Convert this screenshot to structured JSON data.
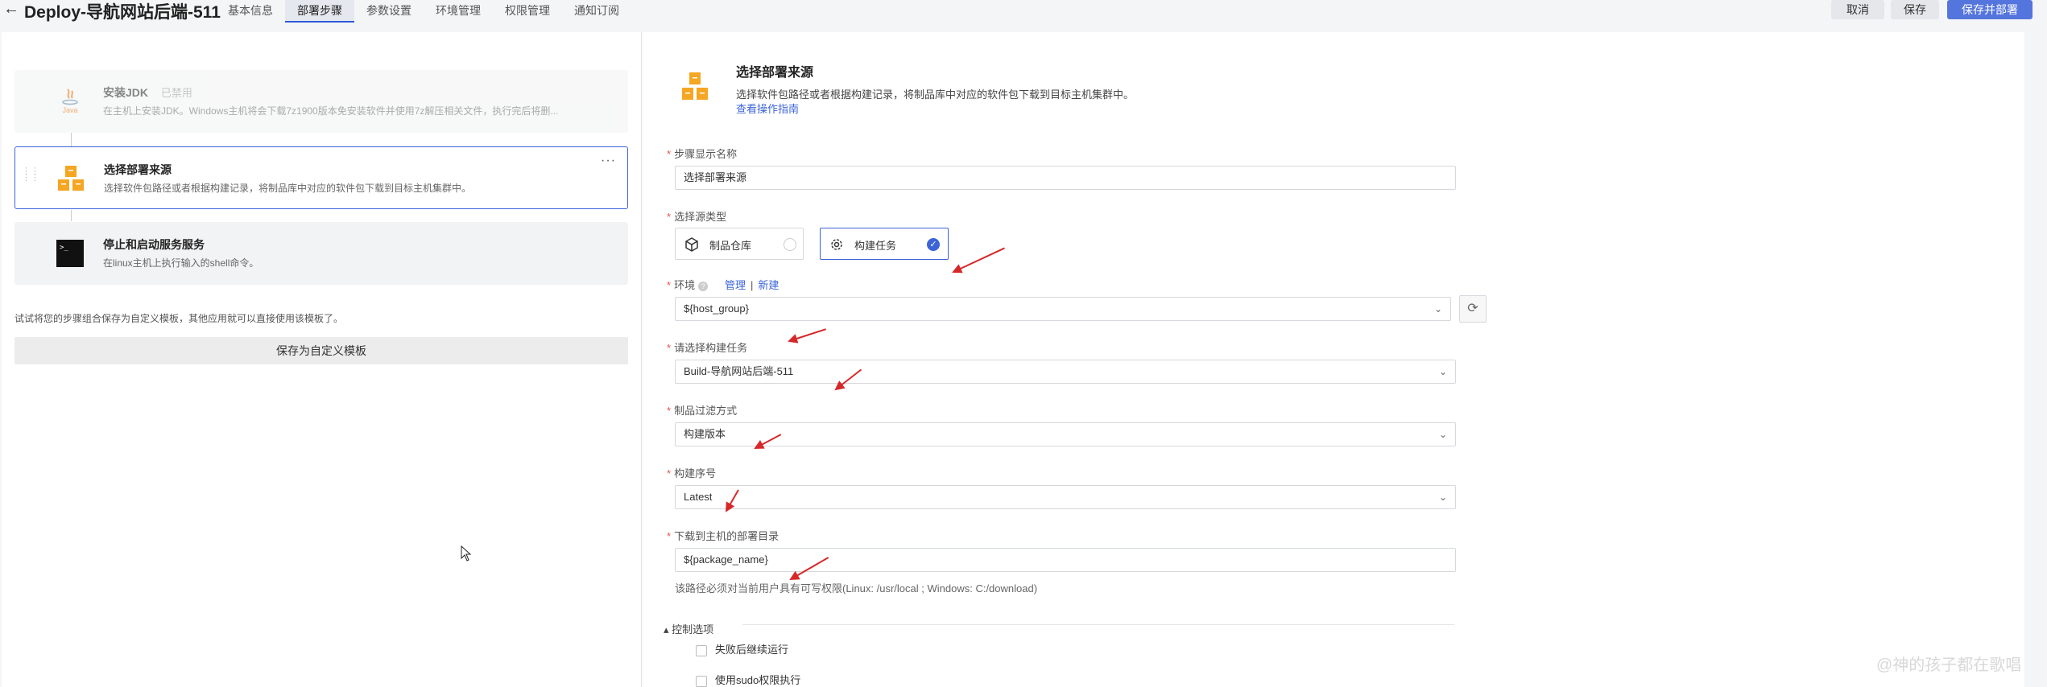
{
  "header": {
    "back_icon": "arrow-left-icon",
    "title": "Deploy-导航网站后端-511",
    "tabs": [
      {
        "label": "基本信息",
        "active": false
      },
      {
        "label": "部署步骤",
        "active": true
      },
      {
        "label": "参数设置",
        "active": false
      },
      {
        "label": "环境管理",
        "active": false
      },
      {
        "label": "权限管理",
        "active": false
      },
      {
        "label": "通知订阅",
        "active": false
      }
    ],
    "cancel_label": "取消",
    "save_label": "保存",
    "save_deploy_label": "保存并部署",
    "accent_color": "#5475dd"
  },
  "steps": [
    {
      "title": "安装JDK",
      "badge": "已禁用",
      "desc": "在主机上安装JDK。Windows主机将会下载7z1900版本免安装软件并使用7z解压相关文件，执行完后将删...",
      "icon": "java-icon",
      "icon_text": "Java",
      "state": "disabled"
    },
    {
      "title": "选择部署来源",
      "desc": "选择软件包路径或者根据构建记录，将制品库中对应的软件包下载到目标主机集群中。",
      "icon": "artifact-boxes-icon",
      "state": "selected"
    },
    {
      "title": "停止和启动服务服务",
      "desc": "在linux主机上执行输入的shell命令。",
      "icon": "terminal-icon",
      "icon_text": ">_",
      "state": "normal"
    }
  ],
  "template": {
    "hint": "试试将您的步骤组合保存为自定义模板，其他应用就可以直接使用该模板了。",
    "button_label": "保存为自定义模板"
  },
  "detail": {
    "title": "选择部署来源",
    "desc": "选择软件包路径或者根据构建记录，将制品库中对应的软件包下载到目标主机集群中。",
    "guide_link": "查看操作指南",
    "step_name_label": "步骤显示名称",
    "step_name_value": "选择部署来源",
    "source_type_label": "选择源类型",
    "source_options": [
      {
        "label": "制品仓库",
        "icon": "cube-icon",
        "selected": false
      },
      {
        "label": "构建任务",
        "icon": "gear-icon",
        "selected": true
      }
    ],
    "env_label": "环境",
    "env_manage": "管理",
    "env_sep": "|",
    "env_new": "新建",
    "env_value": "${host_group}",
    "build_task_label": "请选择构建任务",
    "build_task_value": "Build-导航网站后端-511",
    "filter_label": "制品过滤方式",
    "filter_value": "构建版本",
    "build_no_label": "构建序号",
    "build_no_value": "Latest",
    "deploy_dir_label": "下载到主机的部署目录",
    "deploy_dir_value": "${package_name}",
    "deploy_dir_note": "该路径必须对当前用户具有可写权限(Linux: /usr/local ; Windows: C:/download)",
    "control_label": "控制选项",
    "continue_on_fail": "失败后继续运行",
    "use_sudo": "使用sudo权限执行"
  },
  "watermark": {
    "text": "@神的孩子都在歌唱"
  }
}
